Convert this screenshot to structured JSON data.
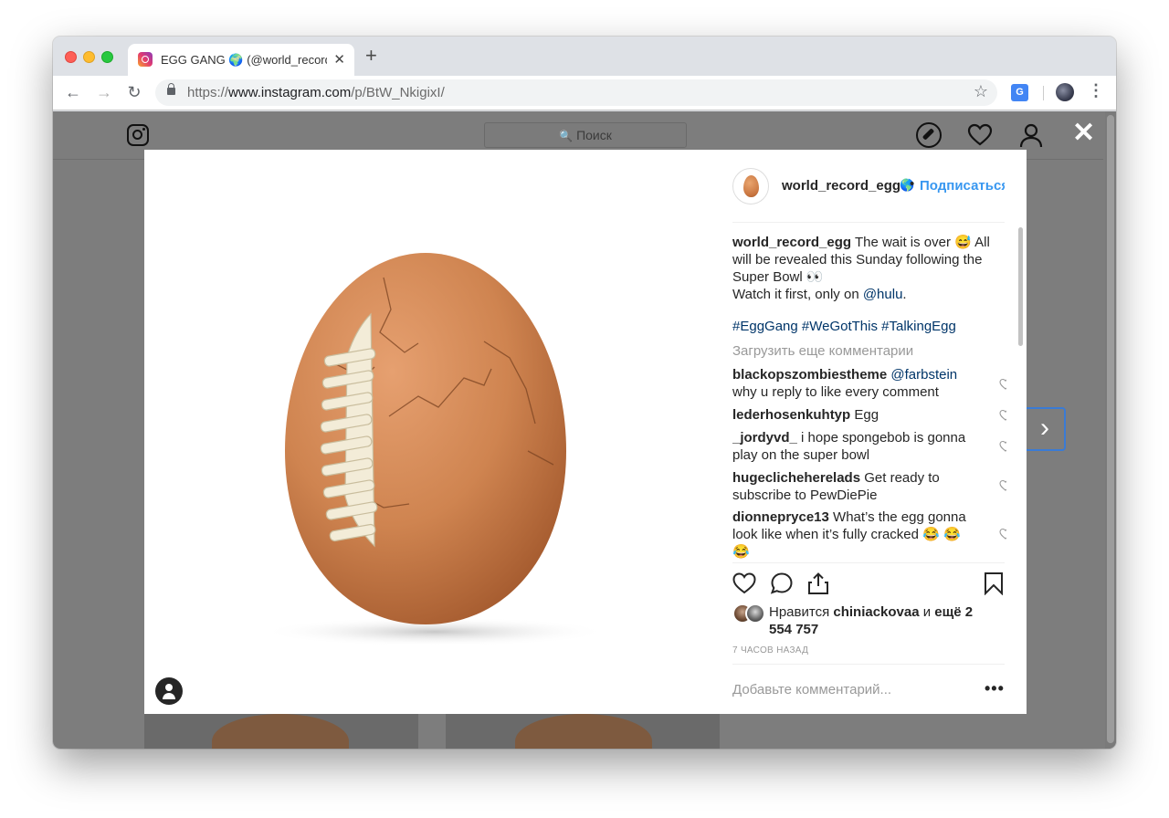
{
  "browser": {
    "tab_title": "EGG GANG 🌍 (@world_record_egg)",
    "tab_close": "✕",
    "new_tab": "+",
    "url_scheme": "https://",
    "url_host": "www.instagram.com",
    "url_path": "/p/BtW_NkigixI/",
    "back": "←",
    "forward": "→",
    "reload": "↻",
    "star": "☆",
    "menu": "⋮",
    "translate_ext": "G"
  },
  "instagram": {
    "search_placeholder": "Поиск",
    "search_icon": "🔍",
    "close": "✕",
    "next": "›"
  },
  "post": {
    "username": "world_record_egg",
    "verified_glyph": "🌎",
    "separator": "•",
    "follow": "Подписаться",
    "caption": {
      "user": "world_record_egg",
      "text1": " The wait is over 😅  All will be revealed this Sunday following the Super Bowl 👀",
      "text2": "Watch it first, only on ",
      "mention": "@hulu",
      "text3": "."
    },
    "hashtags": "#EggGang #WeGotThis #TalkingEgg",
    "load_more": "Загрузить еще комментарии",
    "comments": [
      {
        "user": "blackopszombiestheme",
        "text": " ",
        "mention": "@farbstein",
        "text2": " why u reply to like every comment"
      },
      {
        "user": "lederhosenkuhtyp",
        "text": " Egg",
        "mention": "",
        "text2": ""
      },
      {
        "user": "_jordyvd_",
        "text": " i hope spongebob is gonna play on the super bowl",
        "mention": "",
        "text2": ""
      },
      {
        "user": "hugeclicheherelads",
        "text": " Get ready to subscribe to PewDiePie",
        "mention": "",
        "text2": ""
      },
      {
        "user": "dionnepryce13",
        "text": " What’s the egg gonna look like when it’s fully cracked 😂 😂 😂",
        "mention": "",
        "text2": ""
      }
    ],
    "likes_prefix": "Нравится ",
    "likes_user": "chiniackovaa",
    "likes_mid": " и ",
    "likes_count": "ещё 2 554 757",
    "time_ago": "7 ЧАСОВ НАЗАД",
    "add_comment_placeholder": "Добавьте комментарий...",
    "more_options": "•••"
  },
  "colors": {
    "link_blue": "#3897f0",
    "hashtag_blue": "#003569",
    "overlay_gray": "#7d7d7d"
  }
}
